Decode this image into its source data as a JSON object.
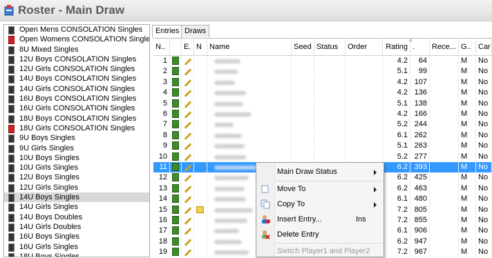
{
  "window": {
    "title": "Roster - Main Draw"
  },
  "events": [
    {
      "label": "Open Mens CONSOLATION Singles",
      "color": "dark"
    },
    {
      "label": "Open Womens CONSOLATION Singles",
      "color": "red"
    },
    {
      "label": "8U Mixed Singles",
      "color": "dark"
    },
    {
      "label": "12U Boys CONSOLATION Singles",
      "color": "dark"
    },
    {
      "label": "12U Girls CONSOLATION Singles",
      "color": "dark"
    },
    {
      "label": "14U Boys CONSOLATION Singles",
      "color": "dark"
    },
    {
      "label": "14U Girls CONSOLATION Singles",
      "color": "dark"
    },
    {
      "label": "16U Boys CONSOLATION Singles",
      "color": "dark"
    },
    {
      "label": "16U Girls CONSOLATION Singles",
      "color": "dark"
    },
    {
      "label": "18U Boys CONSOLATION Singles",
      "color": "dark"
    },
    {
      "label": "18U Girls CONSOLATION Singles",
      "color": "red"
    },
    {
      "label": "9U Boys Singles",
      "color": "dark"
    },
    {
      "label": "9U Girls Singles",
      "color": "dark"
    },
    {
      "label": "10U Boys Singles",
      "color": "dark"
    },
    {
      "label": "10U Girls Singles",
      "color": "dark"
    },
    {
      "label": "12U Boys Singles",
      "color": "dark"
    },
    {
      "label": "12U Girls Singles",
      "color": "dark"
    },
    {
      "label": "14U Boys Singles",
      "color": "dark",
      "selected": true
    },
    {
      "label": "14U Girls Singles",
      "color": "dark"
    },
    {
      "label": "14U Boys Doubles",
      "color": "dark"
    },
    {
      "label": "14U Girls Doubles",
      "color": "dark"
    },
    {
      "label": "16U Boys Singles",
      "color": "dark"
    },
    {
      "label": "16U Girls Singles",
      "color": "dark"
    },
    {
      "label": "18U Boys Singles",
      "color": "dark"
    }
  ],
  "tabs": {
    "entries": "Entries",
    "draws": "Draws"
  },
  "columns": {
    "num": "N..",
    "e": "E.",
    "n": "N",
    "name": "Name",
    "seed": "Seed",
    "status": "Status",
    "order": "Order",
    "rating": "Rating",
    "rank": ".",
    "rec": "Rece...",
    "g": "G..",
    "can": "Car"
  },
  "rows": [
    {
      "num": "1",
      "rating": "4.2",
      "rank": "64",
      "g": "M",
      "can": "No"
    },
    {
      "num": "2",
      "rating": "5.1",
      "rank": "99",
      "g": "M",
      "can": "No"
    },
    {
      "num": "3",
      "rating": "4.2",
      "rank": "107",
      "g": "M",
      "can": "No"
    },
    {
      "num": "4",
      "rating": "4.2",
      "rank": "136",
      "g": "M",
      "can": "No"
    },
    {
      "num": "5",
      "rating": "5.1",
      "rank": "138",
      "g": "M",
      "can": "No"
    },
    {
      "num": "6",
      "rating": "4.2",
      "rank": "166",
      "g": "M",
      "can": "No"
    },
    {
      "num": "7",
      "rating": "5.2",
      "rank": "244",
      "g": "M",
      "can": "No"
    },
    {
      "num": "8",
      "rating": "6.1",
      "rank": "262",
      "g": "M",
      "can": "No"
    },
    {
      "num": "9",
      "rating": "5.1",
      "rank": "263",
      "g": "M",
      "can": "No"
    },
    {
      "num": "10",
      "rating": "5.2",
      "rank": "277",
      "g": "M",
      "can": "No"
    },
    {
      "num": "11",
      "rating": "6.2",
      "rank": "393",
      "g": "M",
      "can": "No",
      "selected": true
    },
    {
      "num": "12",
      "rating": "6.2",
      "rank": "425",
      "g": "M",
      "can": "No"
    },
    {
      "num": "13",
      "rating": "6.2",
      "rank": "463",
      "g": "M",
      "can": "No"
    },
    {
      "num": "14",
      "rating": "6.1",
      "rank": "480",
      "g": "M",
      "can": "No"
    },
    {
      "num": "15",
      "rating": "7.2",
      "rank": "805",
      "g": "M",
      "can": "No",
      "note": true
    },
    {
      "num": "16",
      "rating": "7.2",
      "rank": "855",
      "g": "M",
      "can": "No"
    },
    {
      "num": "17",
      "rating": "6.1",
      "rank": "906",
      "g": "M",
      "can": "No"
    },
    {
      "num": "18",
      "rating": "6.2",
      "rank": "947",
      "g": "M",
      "can": "No"
    },
    {
      "num": "19",
      "rating": "7.2",
      "rank": "967",
      "g": "M",
      "can": "No"
    }
  ],
  "context_menu": {
    "main_draw_status": "Main Draw Status",
    "move_to": "Move To",
    "copy_to": "Copy To",
    "insert_entry": "Insert Entry...",
    "insert_shortcut": "Ins",
    "delete_entry": "Delete Entry",
    "switch_players": "Switch Player1 and Player2"
  },
  "colors": {
    "selection": "#3399ff",
    "accent_red": "#d21f1f",
    "entry_green": "#3d8c2a"
  }
}
